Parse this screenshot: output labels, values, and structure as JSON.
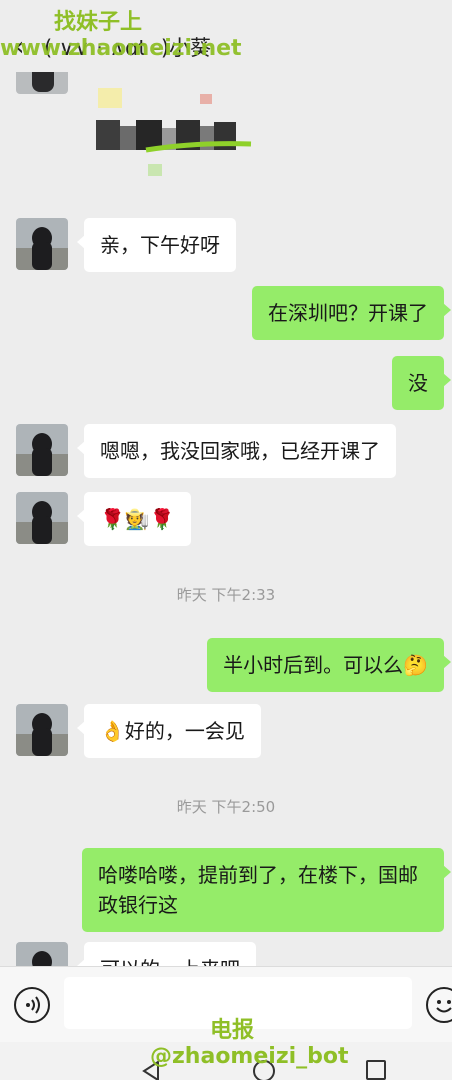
{
  "header": {
    "back_glyph": "‹",
    "title": "( ∨∨ ·  ∧ɑt -)小葵"
  },
  "messages": [
    {
      "side": "recv",
      "text": "亲，下午好呀"
    },
    {
      "side": "sent",
      "text": "在深圳吧？开课了"
    },
    {
      "side": "sent",
      "text": "没"
    },
    {
      "side": "recv",
      "text": "嗯嗯，我没回家哦，已经开课了"
    },
    {
      "side": "recv",
      "text": "🌹🧑‍🌾🌹"
    },
    {
      "side": "time",
      "text": "昨天 下午2:33"
    },
    {
      "side": "sent",
      "text": "半小时后到。可以么🤔"
    },
    {
      "side": "recv",
      "text": "👌好的，一会见"
    },
    {
      "side": "time",
      "text": "昨天 下午2:50"
    },
    {
      "side": "sent",
      "text": "哈喽哈喽，提前到了，在楼下，国邮政银行这"
    },
    {
      "side": "recv",
      "text": "可以的，上来吧"
    }
  ],
  "input": {
    "placeholder": ""
  },
  "icons": {
    "voice": "voice-icon",
    "emoji": "emoji-icon",
    "nav_back": "triangle-back-icon",
    "nav_home": "circle-home-icon",
    "nav_recent": "square-recent-icon"
  },
  "watermark": {
    "top_line1": "找妹子上",
    "top_line2": "www.zhaomeizi.net",
    "bottom_line1": "电报",
    "bottom_line2": "@zhaomeizi_bot"
  },
  "colors": {
    "background": "#ededed",
    "sent_bubble": "#95ec69",
    "received_bubble": "#ffffff",
    "watermark": "#8fbf27",
    "timestamp": "#9a9a9a"
  }
}
